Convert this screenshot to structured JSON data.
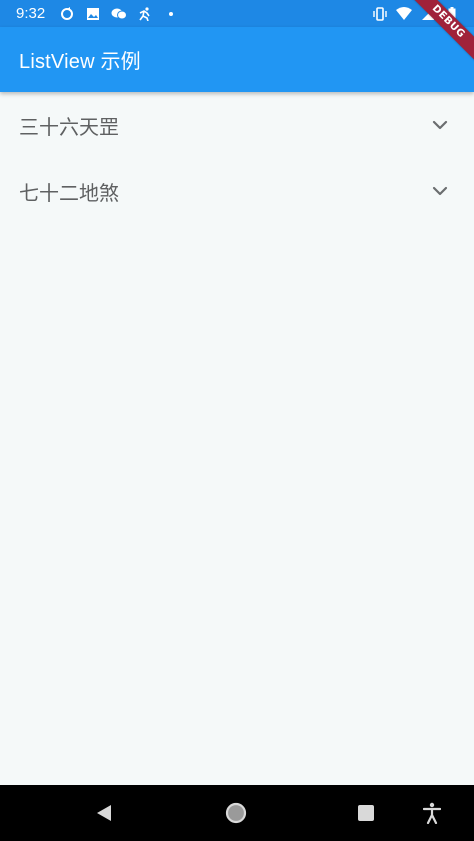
{
  "status_bar": {
    "time": "9:32",
    "left_icons": [
      "sync-icon",
      "image-icon",
      "chat-icon",
      "run-icon",
      "dot-icon"
    ],
    "right_icons": [
      "vibrate-icon",
      "wifi-icon",
      "signal-icon",
      "battery-icon"
    ]
  },
  "app_bar": {
    "title": "ListView 示例",
    "color": "#2196f3"
  },
  "debug_banner": {
    "label": "DEBUG",
    "color": "#a0223a"
  },
  "list": {
    "items": [
      {
        "title": "三十六天罡",
        "icon": "chevron-down-icon"
      },
      {
        "title": "七十二地煞",
        "icon": "chevron-down-icon"
      }
    ]
  },
  "nav_bar": {
    "buttons": [
      "back-icon",
      "home-icon",
      "recents-icon",
      "accessibility-icon"
    ]
  }
}
